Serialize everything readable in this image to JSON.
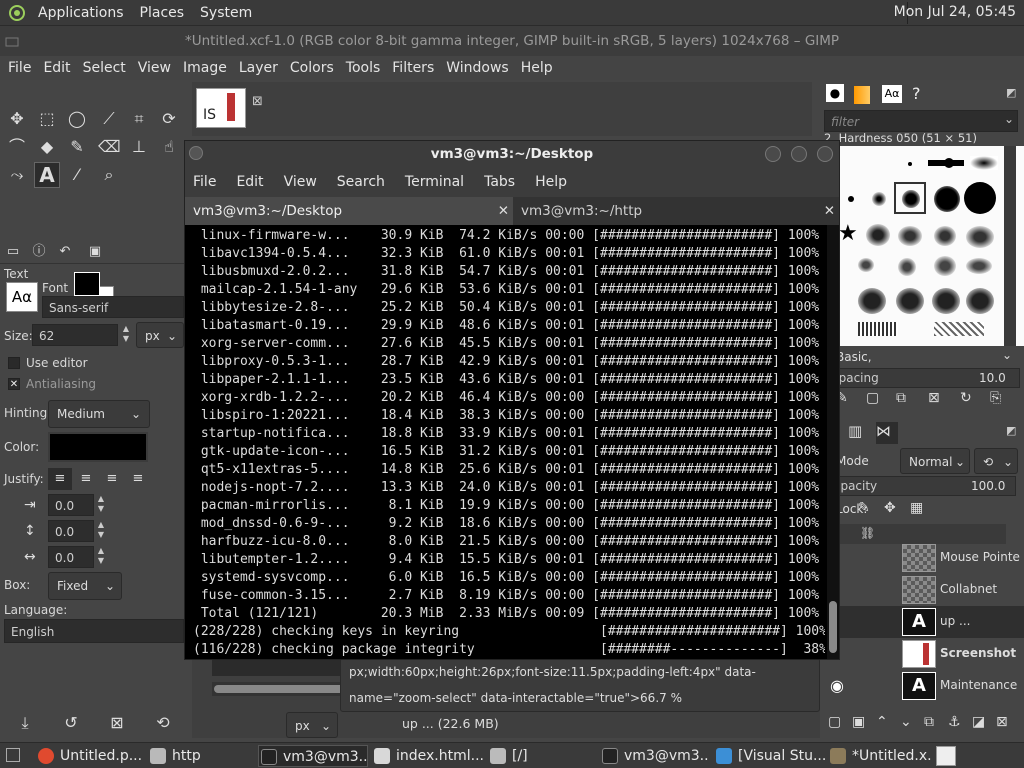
{
  "top_panel": {
    "menus": [
      "Applications",
      "Places",
      "System"
    ],
    "clock": "Mon Jul 24, 05:45"
  },
  "gimp": {
    "title": "*Untitled.xcf-1.0 (RGB color 8-bit gamma integer, GIMP built-in sRGB, 5 layers) 1024x768 – GIMP",
    "menus": [
      "File",
      "Edit",
      "Select",
      "View",
      "Image",
      "Layer",
      "Colors",
      "Tools",
      "Filters",
      "Windows",
      "Help"
    ],
    "tool_options": {
      "section": "Text",
      "font_label": "Font",
      "font_value": "Sans-serif",
      "font_preview": "Aα",
      "size_label": "Size:",
      "size_value": "62",
      "size_unit": "px",
      "use_editor": "Use editor",
      "antialiasing": "Antialiasing",
      "hinting_label": "Hinting:",
      "hinting_value": "Medium",
      "color_label": "Color:",
      "justify_label": "Justify:",
      "indent_value": "0.0",
      "line_spacing_value": "0.0",
      "letter_spacing_value": "0.0",
      "box_label": "Box:",
      "box_value": "Fixed",
      "language_label": "Language:",
      "language_value": "English"
    },
    "brushes": {
      "filter_placeholder": "filter",
      "brush_name": "2. Hardness 050 (51 × 51)",
      "preset": "Basic,",
      "spacing_label": "Spacing",
      "spacing_value": "10.0"
    },
    "layers": {
      "mode_label": "Mode",
      "mode_value": "Normal",
      "opacity_label": "Opacity",
      "opacity_value": "100.0",
      "lock_label": "Lock:",
      "items": [
        {
          "name": "Mouse Pointe",
          "visible": false
        },
        {
          "name": "Collabnet",
          "visible": false
        },
        {
          "name": "up ...",
          "visible": false
        },
        {
          "name": "Screenshot",
          "visible": false
        },
        {
          "name": "Maintenance",
          "visible": true
        }
      ]
    },
    "statusbar": {
      "unit": "px",
      "zoom": "66.7 %",
      "message": "up ... (22.6 MB)"
    },
    "canvas_thumb_text": "IS"
  },
  "terminal": {
    "title": "vm3@vm3:~/Desktop",
    "menus": [
      "File",
      "Edit",
      "View",
      "Search",
      "Terminal",
      "Tabs",
      "Help"
    ],
    "tabs": [
      {
        "label": "vm3@vm3:~/Desktop",
        "active": true
      },
      {
        "label": "vm3@vm3:~/http",
        "active": false
      }
    ],
    "lines": [
      " linux-firmware-w...    30.9 KiB  74.2 KiB/s 00:00 [######################] 100%",
      " libavc1394-0.5.4...    32.3 KiB  61.0 KiB/s 00:01 [######################] 100%",
      " libusbmuxd-2.0.2...    31.8 KiB  54.7 KiB/s 00:01 [######################] 100%",
      " mailcap-2.1.54-1-any   29.6 KiB  53.6 KiB/s 00:01 [######################] 100%",
      " libbytesize-2.8-...    25.2 KiB  50.4 KiB/s 00:01 [######################] 100%",
      " libatasmart-0.19...    29.9 KiB  48.6 KiB/s 00:01 [######################] 100%",
      " xorg-server-comm...    27.6 KiB  45.5 KiB/s 00:01 [######################] 100%",
      " libproxy-0.5.3-1...    28.7 KiB  42.9 KiB/s 00:01 [######################] 100%",
      " libpaper-2.1.1-1...    23.5 KiB  43.6 KiB/s 00:01 [######################] 100%",
      " xorg-xrdb-1.2.2-...    20.2 KiB  46.4 KiB/s 00:00 [######################] 100%",
      " libspiro-1:20221...    18.4 KiB  38.3 KiB/s 00:00 [######################] 100%",
      " startup-notifica...    18.8 KiB  33.9 KiB/s 00:01 [######################] 100%",
      " gtk-update-icon-...    16.5 KiB  31.2 KiB/s 00:01 [######################] 100%",
      " qt5-x11extras-5....    14.8 KiB  25.6 KiB/s 00:01 [######################] 100%",
      " nodejs-nopt-7.2....    13.3 KiB  24.0 KiB/s 00:01 [######################] 100%",
      " pacman-mirrorlis...     8.1 KiB  19.9 KiB/s 00:00 [######################] 100%",
      " mod_dnssd-0.6-9-...     9.2 KiB  18.6 KiB/s 00:00 [######################] 100%",
      " harfbuzz-icu-8.0...     8.0 KiB  21.5 KiB/s 00:00 [######################] 100%",
      " libutempter-1.2....     9.4 KiB  15.5 KiB/s 00:01 [######################] 100%",
      " systemd-sysvcomp...     6.0 KiB  16.5 KiB/s 00:00 [######################] 100%",
      " fuse-common-3.15...     2.7 KiB  8.19 KiB/s 00:00 [######################] 100%",
      " Total (121/121)        20.3 MiB  2.33 MiB/s 00:09 [######################] 100%",
      "(228/228) checking keys in keyring                  [######################] 100%",
      "(116/228) checking package integrity                [########--------------]  38%"
    ]
  },
  "taskbar": {
    "items": [
      {
        "label": "Untitled.p...",
        "color": "#e04a2f"
      },
      {
        "label": "http",
        "color": "#b9b9b9"
      },
      {
        "label": "vm3@vm3...",
        "color": "#222222",
        "active": true
      },
      {
        "label": "index.html...",
        "color": "#d8d8d8"
      },
      {
        "label": "[/]",
        "color": "#bbbbbb"
      },
      {
        "label": "vm3@vm3...",
        "color": "#222222"
      },
      {
        "label": "[Visual Stu...",
        "color": "#3c8fd6"
      },
      {
        "label": "*Untitled.x...",
        "color": "#8c7b5a"
      }
    ]
  }
}
